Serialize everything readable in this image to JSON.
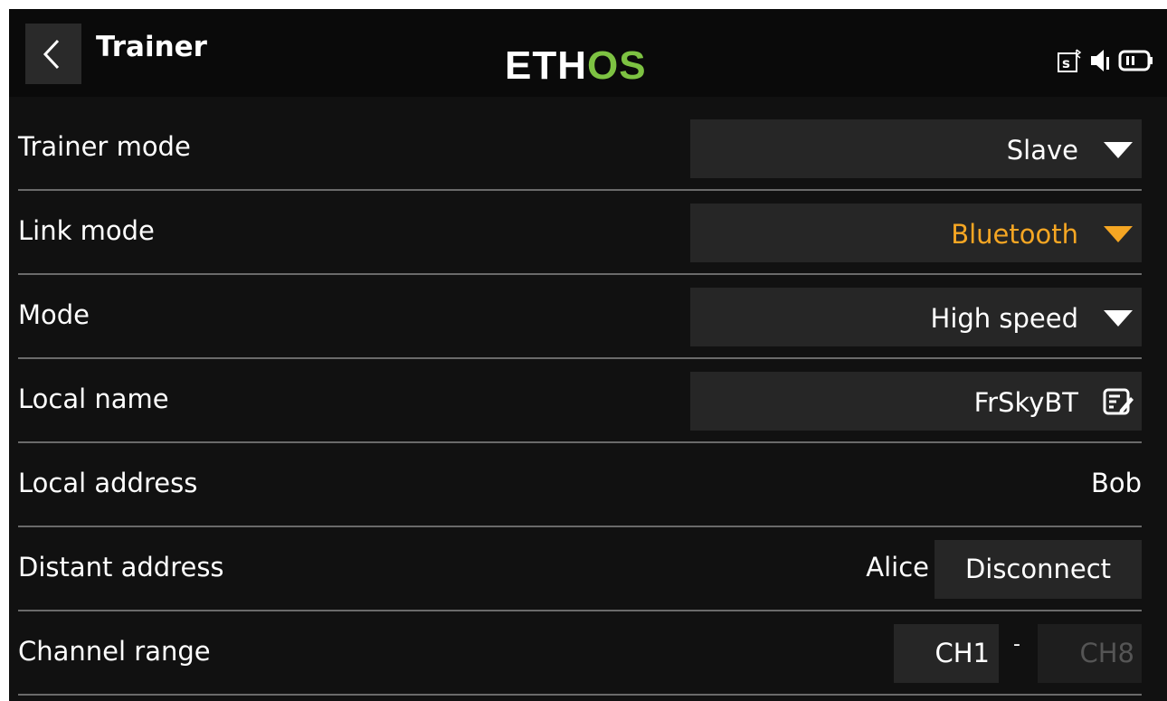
{
  "header": {
    "back_icon": "chevron-left-icon",
    "title": "Trainer",
    "logo_part1": "ETH",
    "logo_part2": "OS",
    "status_icons": [
      "sd-card-bluetooth-icon",
      "speaker-icon",
      "battery-icon"
    ]
  },
  "rows": [
    {
      "label": "Trainer mode",
      "value": "Slave",
      "type": "dropdown"
    },
    {
      "label": "Link mode",
      "value": "Bluetooth",
      "type": "dropdown",
      "highlight_color": "#f5a623"
    },
    {
      "label": "Mode",
      "value": "High speed",
      "type": "dropdown"
    },
    {
      "label": "Local name",
      "value": "FrSkyBT",
      "type": "text-edit",
      "icon": "edit-icon"
    },
    {
      "label": "Local address",
      "value": "Bob",
      "type": "static"
    },
    {
      "label": "Distant address",
      "value": "Alice",
      "button_label": "Disconnect"
    },
    {
      "label": "Channel range",
      "start": "CH1",
      "separator": "-",
      "end": "CH8"
    }
  ],
  "colors": {
    "background": "#111111",
    "field": "#262626",
    "accent": "#f5a623",
    "logo_green": "#7dc242"
  }
}
